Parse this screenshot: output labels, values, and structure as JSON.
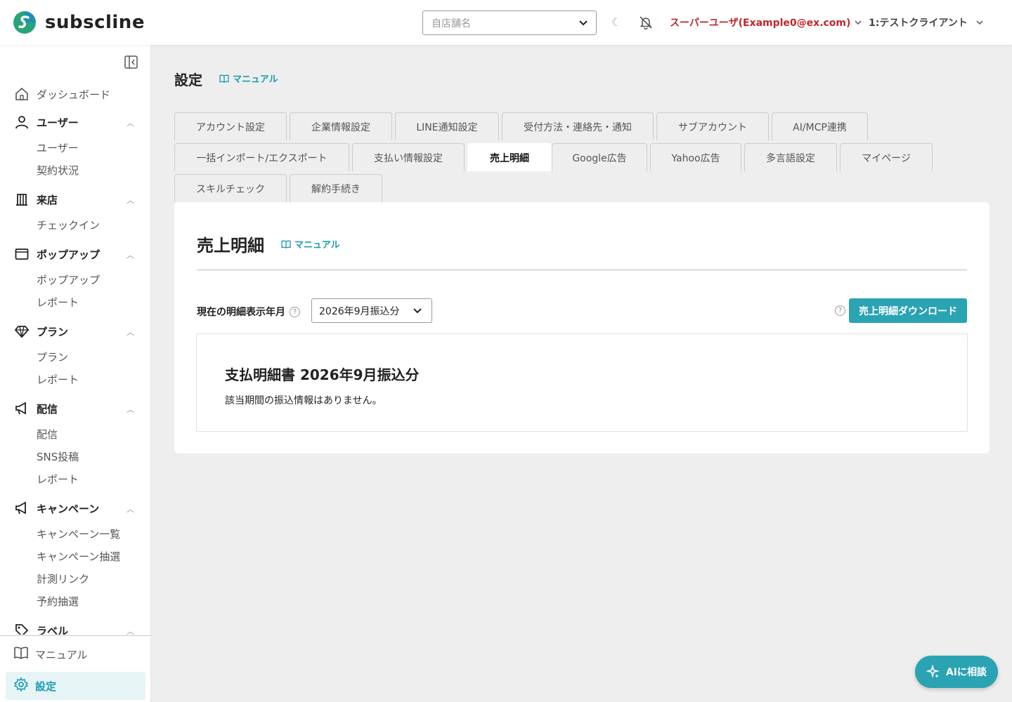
{
  "header": {
    "logo_text": "subscline",
    "store_placeholder": "自店舗名",
    "user_label": "スーパーユーザ(Example0@ex.com)",
    "client_label": "1:テストクライアント"
  },
  "sidebar": {
    "sections": [
      {
        "label": "ダッシュボード",
        "icon": "home-icon",
        "type": "item"
      },
      {
        "label": "ユーザー",
        "icon": "user-icon",
        "type": "section",
        "children": [
          "ユーザー",
          "契約状況"
        ]
      },
      {
        "label": "来店",
        "icon": "building-icon",
        "type": "section",
        "children": [
          "チェックイン"
        ]
      },
      {
        "label": "ポップアップ",
        "icon": "window-icon",
        "type": "section",
        "children": [
          "ポップアップ",
          "レポート"
        ]
      },
      {
        "label": "プラン",
        "icon": "diamond-icon",
        "type": "section",
        "children": [
          "プラン",
          "レポート"
        ]
      },
      {
        "label": "配信",
        "icon": "megaphone-icon",
        "type": "section",
        "children": [
          "配信",
          "SNS投稿",
          "レポート"
        ]
      },
      {
        "label": "キャンペーン",
        "icon": "megaphone-icon",
        "type": "section",
        "children": [
          "キャンペーン一覧",
          "キャンペーン抽選",
          "計測リンク",
          "予約抽選"
        ]
      },
      {
        "label": "ラベル",
        "icon": "tag-icon",
        "type": "section",
        "children": []
      }
    ],
    "bottom": {
      "manual_label": "マニュアル",
      "settings_label": "設定"
    }
  },
  "main": {
    "page_title": "設定",
    "manual_label": "マニュアル",
    "tabs": [
      [
        "アカウント設定",
        "企業情報設定",
        "LINE通知設定",
        "受付方法・連絡先・通知",
        "サブアカウント",
        "AI/MCP連携"
      ],
      [
        "一括インポート/エクスポート",
        "支払い情報設定",
        "売上明細",
        "Google広告",
        "Yahoo広告",
        "多言語設定",
        "マイページ"
      ],
      [
        "スキルチェック",
        "解約手続き"
      ]
    ],
    "active_tab": "売上明細",
    "card": {
      "title": "売上明細",
      "manual_label": "マニュアル",
      "period_label": "現在の明細表示年月",
      "period_value": "2026年9月振込分",
      "download_label": "売上明細ダウンロード",
      "statement_title": "支払明細書 2026年9月振込分",
      "statement_message": "該当期間の振込情報はありません。"
    }
  },
  "ai_button_label": "AIに相談",
  "colors": {
    "accent": "#2aa3b3",
    "user_red": "#c0262d"
  }
}
